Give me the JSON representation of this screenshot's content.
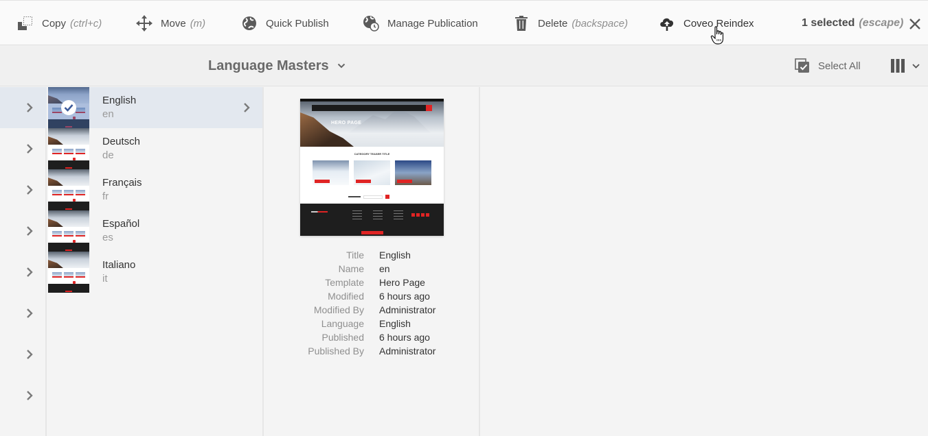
{
  "actionbar": {
    "actions": [
      {
        "id": "copy",
        "label": "Copy",
        "hint": "(ctrl+c)",
        "icon": "copy-icon"
      },
      {
        "id": "move",
        "label": "Move",
        "hint": "(m)",
        "icon": "move-icon"
      },
      {
        "id": "quick-publish",
        "label": "Quick Publish",
        "hint": "",
        "icon": "globe-icon"
      },
      {
        "id": "manage-publication",
        "label": "Manage Publication",
        "hint": "",
        "icon": "globe-clock-icon"
      },
      {
        "id": "delete",
        "label": "Delete",
        "hint": "(backspace)",
        "icon": "trash-icon"
      },
      {
        "id": "coveo-reindex",
        "label": "Coveo Reindex",
        "hint": "",
        "icon": "cloud-upload-icon"
      }
    ],
    "selection": {
      "count_label": "1 selected",
      "hint": "(escape)"
    },
    "close_icon": "close-icon"
  },
  "titlebar": {
    "title": "Language Masters",
    "select_all_label": "Select All",
    "view_icon": "column-view-icon"
  },
  "columns": {
    "parent_rows": 8,
    "items": [
      {
        "title": "English",
        "name": "en",
        "selected": true,
        "has_children": true
      },
      {
        "title": "Deutsch",
        "name": "de",
        "selected": false,
        "has_children": false
      },
      {
        "title": "Français",
        "name": "fr",
        "selected": false,
        "has_children": false
      },
      {
        "title": "Español",
        "name": "es",
        "selected": false,
        "has_children": false
      },
      {
        "title": "Italiano",
        "name": "it",
        "selected": false,
        "has_children": false
      }
    ]
  },
  "preview": {
    "hero_text": "HERO PAGE",
    "section_title": "CATEGORY TEASER TITLE",
    "metadata": [
      {
        "label": "Title",
        "value": "English"
      },
      {
        "label": "Name",
        "value": "en"
      },
      {
        "label": "Template",
        "value": "Hero Page"
      },
      {
        "label": "Modified",
        "value": "6 hours ago"
      },
      {
        "label": "Modified By",
        "value": "Administrator"
      },
      {
        "label": "Language",
        "value": "English"
      },
      {
        "label": "Published",
        "value": "6 hours ago"
      },
      {
        "label": "Published By",
        "value": "Administrator"
      }
    ]
  },
  "colors": {
    "selected_row": "#e3e8ef",
    "accent_red": "#e02424",
    "icon_gray": "#5a5a5a"
  }
}
